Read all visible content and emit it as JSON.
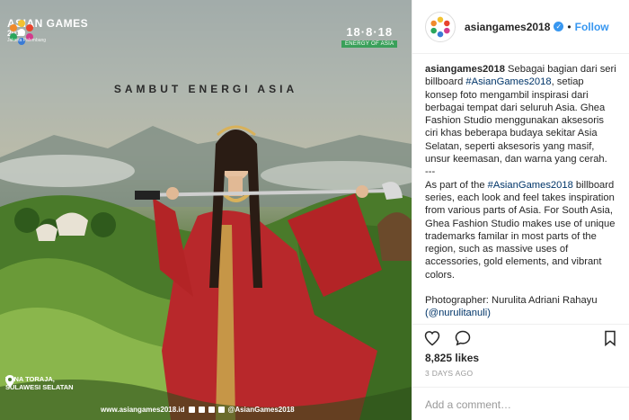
{
  "image": {
    "logo_title": "ASIAN GAMES",
    "logo_year": "2018",
    "logo_sub": "Jakarta Palembang",
    "date": "18·8·18",
    "date_tagline": "ENERGY OF ASIA",
    "headline": "SAMBUT ENERGI ASIA",
    "location_line1": "TANA TORAJA,",
    "location_line2": "SULAWESI SELATAN",
    "website": "www.asiangames2018.id",
    "social_handle": "@AsianGames2018"
  },
  "post": {
    "username": "asiangames2018",
    "verified_icon": "verified-badge-icon",
    "follow_label": "Follow",
    "caption_user": "asiangames2018",
    "caption_id_1": " Sebagai bagian dari seri billboard ",
    "hashtag": "#AsianGames2018",
    "caption_id_2": ", setiap konsep foto mengambil inspirasi dari berbagai tempat dari seluruh Asia. Ghea Fashion Studio menggunakan aksesoris ciri khas beberapa budaya sekitar Asia Selatan, seperti aksesoris yang masif, unsur keemasan, dan warna yang cerah.",
    "separator": "---",
    "caption_en_1": "As part of the ",
    "caption_en_2": " billboard series, each look and feel takes inspiration from various parts of Asia. For South Asia, Ghea Fashion Studio makes use of unique trademarks familar in most parts of the region, such as massive uses of accessories, gold elements, and vibrant colors.",
    "photographer_label": "Photographer: Nurulita Adriani Rahayu",
    "photographer_handle": "(@nurulitanuli)",
    "likes": "8,825 likes",
    "time_ago": "3 DAYS AGO",
    "comment_placeholder": "Add a comment…"
  },
  "colors": {
    "accent": "#3897f0",
    "text": "#262626",
    "muted": "#999999",
    "hashtag": "#003569"
  }
}
